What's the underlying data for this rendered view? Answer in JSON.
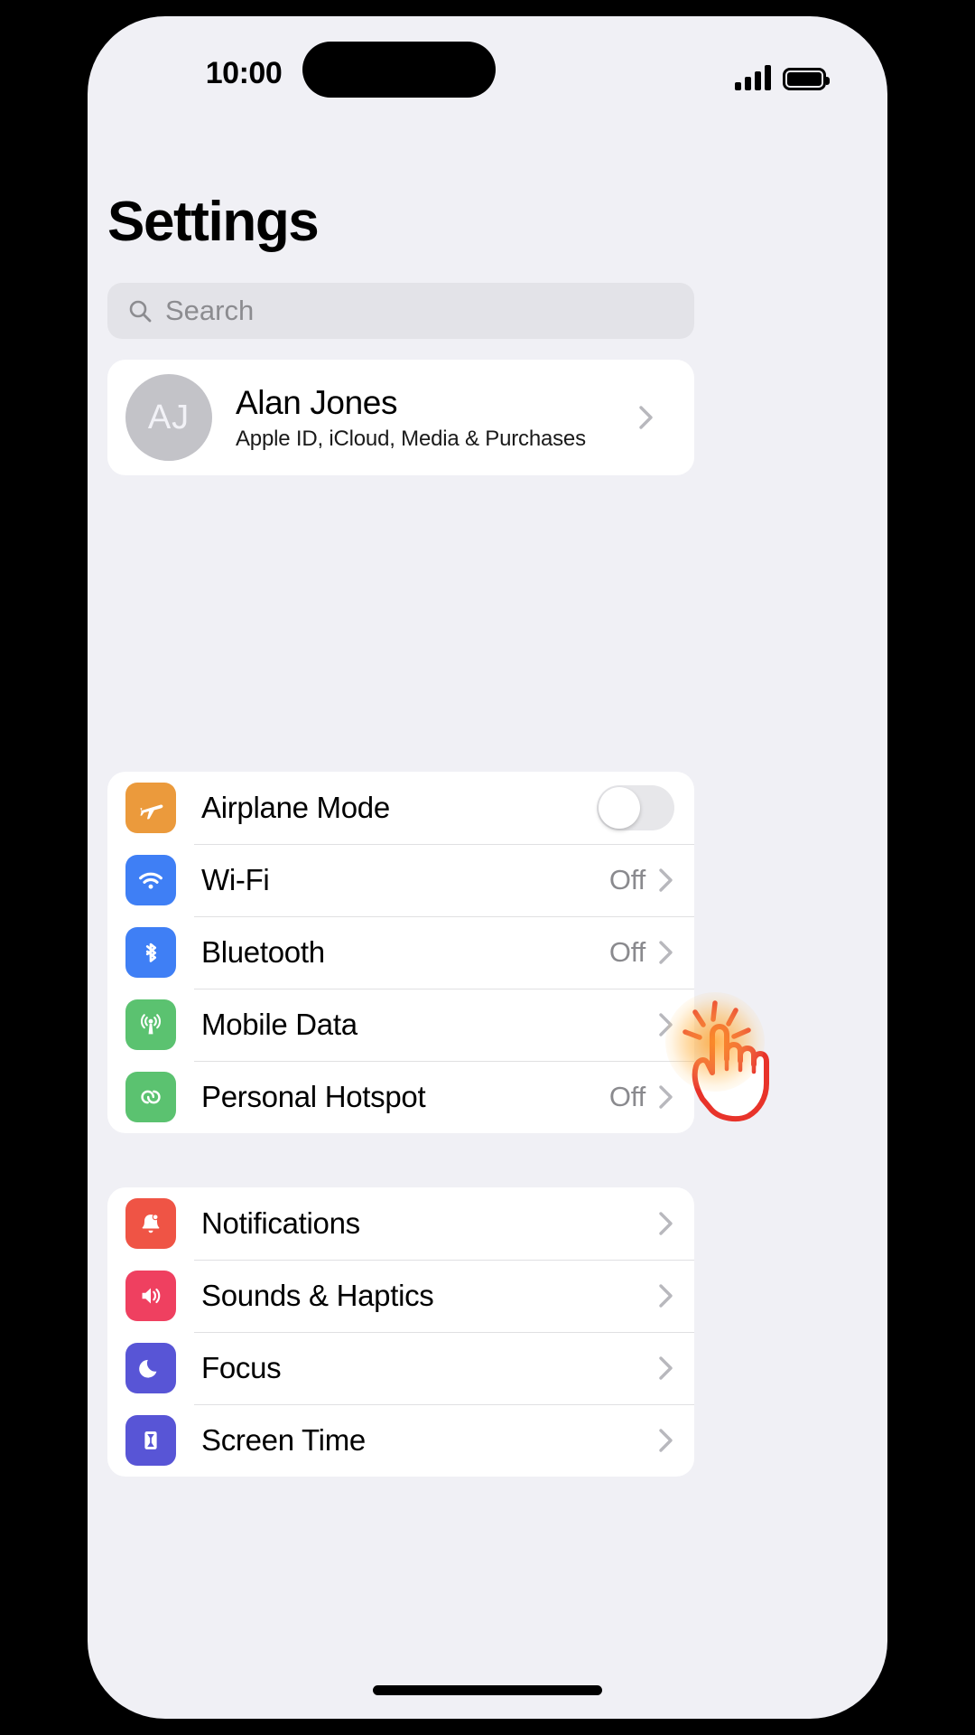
{
  "status_bar": {
    "time": "10:00",
    "signal_icon": "cellular-signal-icon",
    "battery_icon": "battery-full-icon"
  },
  "header": {
    "title": "Settings"
  },
  "search": {
    "placeholder": "Search",
    "value": "",
    "icon": "search-icon"
  },
  "account": {
    "initials": "AJ",
    "name": "Alan Jones",
    "subtitle": "Apple ID, iCloud, Media & Purchases",
    "chevron": "chevron-right-icon"
  },
  "groups": [
    {
      "id": "connectivity",
      "rows": [
        {
          "label": "Airplane Mode",
          "icon": "airplane-icon",
          "icon_color": "#eb9a3c",
          "control": "toggle",
          "toggle_on": false,
          "value": ""
        },
        {
          "label": "Wi-Fi",
          "icon": "wifi-icon",
          "icon_color": "#3f7ff5",
          "control": "chevron",
          "value": "Off"
        },
        {
          "label": "Bluetooth",
          "icon": "bluetooth-icon",
          "icon_color": "#3f7ff5",
          "control": "chevron",
          "value": "Off"
        },
        {
          "label": "Mobile Data",
          "icon": "cellular-antenna-icon",
          "icon_color": "#5bc270",
          "control": "chevron",
          "value": ""
        },
        {
          "label": "Personal Hotspot",
          "icon": "hotspot-link-icon",
          "icon_color": "#5bc270",
          "control": "chevron",
          "value": "Off"
        }
      ]
    },
    {
      "id": "system",
      "rows": [
        {
          "label": "Notifications",
          "icon": "bell-icon",
          "icon_color": "#ef5445",
          "control": "chevron",
          "value": ""
        },
        {
          "label": "Sounds & Haptics",
          "icon": "speaker-icon",
          "icon_color": "#ef4060",
          "control": "chevron",
          "value": ""
        },
        {
          "label": "Focus",
          "icon": "moon-icon",
          "icon_color": "#5855d6",
          "control": "chevron",
          "value": ""
        },
        {
          "label": "Screen Time",
          "icon": "hourglass-icon",
          "icon_color": "#5855d6",
          "control": "chevron",
          "value": ""
        }
      ]
    }
  ],
  "cursor": {
    "icon": "tap-hand-cursor",
    "target_label": "Mobile Data",
    "accent_color": "#e8332a",
    "glow_color": "#ffa028"
  },
  "home_indicator": "home-indicator"
}
